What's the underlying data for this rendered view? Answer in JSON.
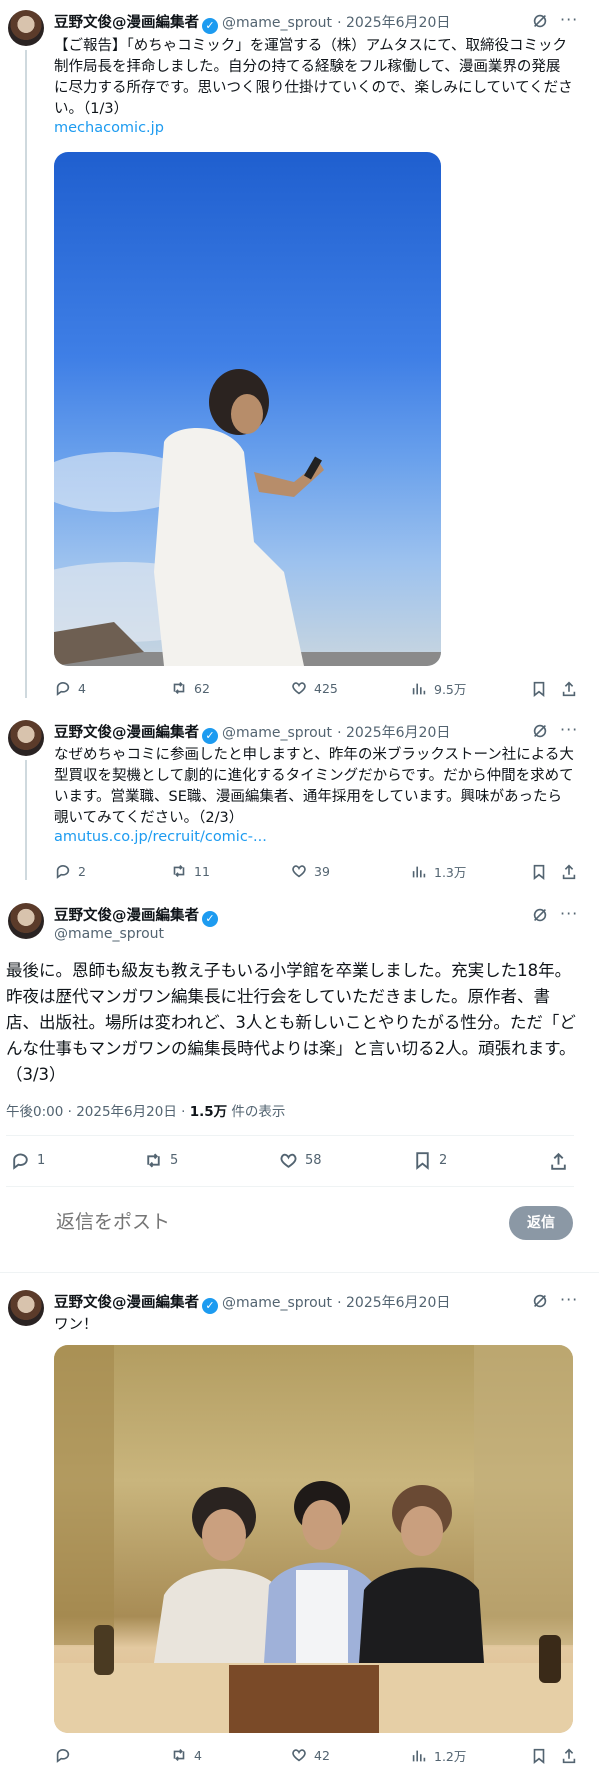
{
  "tweet1": {
    "display_name": "豆野文俊@漫画編集者",
    "handle": "@mame_sprout",
    "date": "· 2025年6月20日",
    "text": "【ご報告】「めちゃコミック」を運営する（株）アムタスにて、取締役コミック制作局長を拝命しました。自分の持てる経験をフル稼働して、漫画業界の発展に尽力する所存です。思いつく限り仕掛けていくので、楽しみにしていてください。（1/3）",
    "link": "mechacomic.jp",
    "replies": "4",
    "reposts": "62",
    "likes": "425",
    "views": "9.5万"
  },
  "tweet2": {
    "display_name": "豆野文俊@漫画編集者",
    "handle": "@mame_sprout",
    "date": "· 2025年6月20日",
    "text": "なぜめちゃコミに参画したと申しますと、昨年の米ブラックストーン社による大型買収を契機として劇的に進化するタイミングだからです。だから仲間を求めています。営業職、SE職、漫画編集者、通年採用をしています。興味があったら覗いてみてください。（2/3）",
    "link": "amutus.co.jp/recruit/comic-...",
    "replies": "2",
    "reposts": "11",
    "likes": "39",
    "views": "1.3万"
  },
  "main_tweet": {
    "display_name": "豆野文俊@漫画編集者",
    "handle": "@mame_sprout",
    "text": "最後に。恩師も級友も教え子もいる小学館を卒業しました。充実した18年。昨夜は歴代マンガワン編集長に壮行会をしていただきました。原作者、書店、出版社。場所は変われど、3人とも新しいことやりたがる性分。ただ「どんな仕事もマンガワンの編集長時代よりは楽」と言い切る2人。頑張れます。（3/3）",
    "timestamp": "午後0:00 · 2025年6月20日 · ",
    "views_count": "1.5万",
    "views_label": " 件の表示",
    "replies": "1",
    "reposts": "5",
    "likes": "58",
    "bookmarks": "2"
  },
  "reply_box": {
    "placeholder": "返信をポスト",
    "button": "返信"
  },
  "tweet4": {
    "display_name": "豆野文俊@漫画編集者",
    "handle": "@mame_sprout",
    "date": "· 2025年6月20日",
    "text": "ワン！",
    "replies": "",
    "reposts": "4",
    "likes": "42",
    "views": "1.2万"
  },
  "colors": {
    "accent": "#1d9bf0",
    "secondary_text": "#536471",
    "divider": "#eff3f4"
  }
}
